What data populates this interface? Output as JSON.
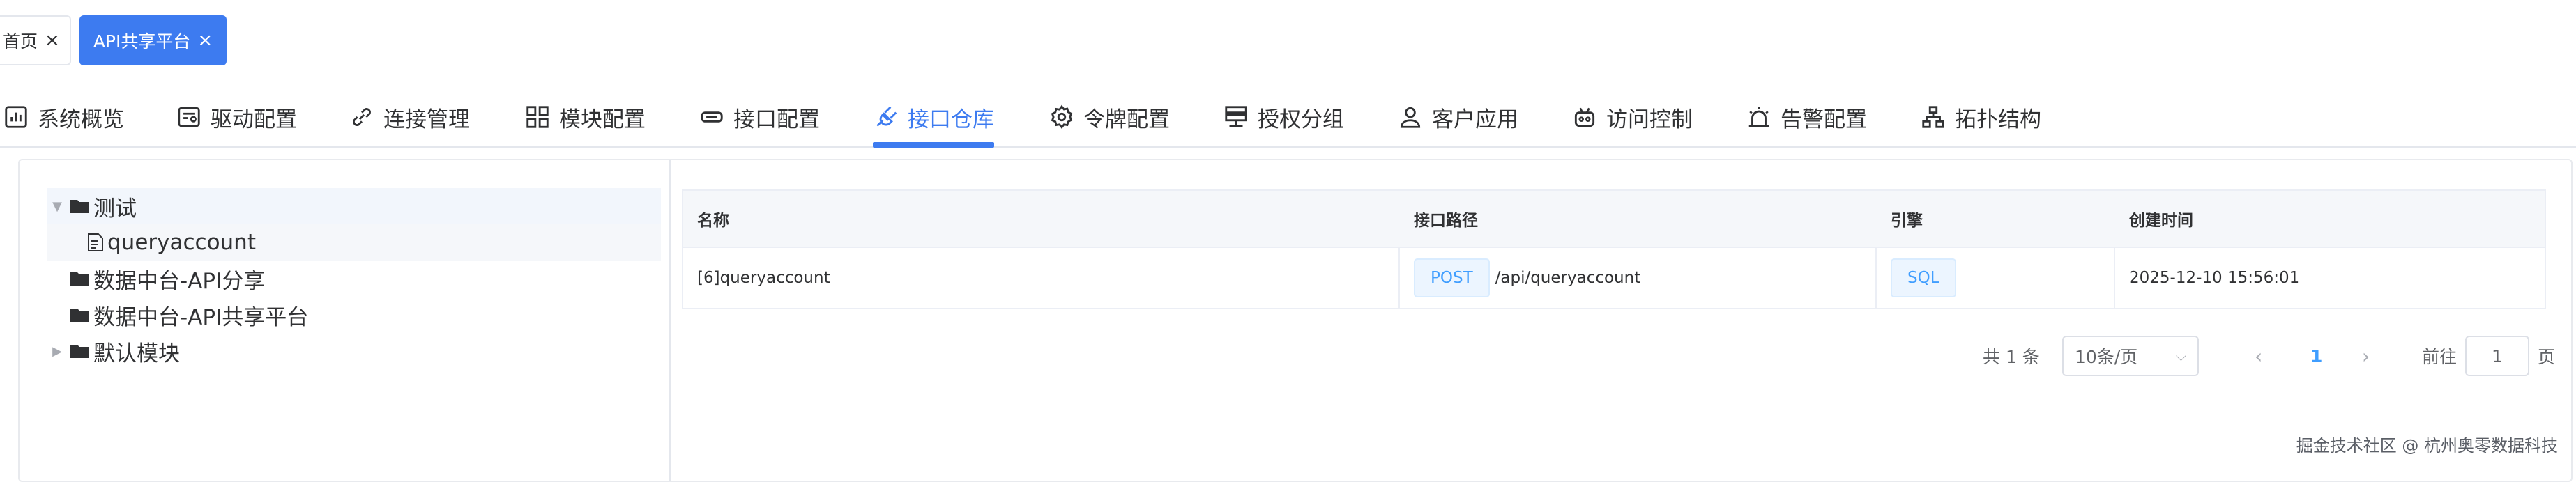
{
  "tags": [
    {
      "label": "首页",
      "close": "×"
    },
    {
      "label": "API共享平台",
      "close": "×"
    }
  ],
  "tabs": [
    {
      "label": "系统概览",
      "icon": "bar-chart-icon"
    },
    {
      "label": "驱动配置",
      "icon": "driver-icon"
    },
    {
      "label": "连接管理",
      "icon": "link-icon"
    },
    {
      "label": "模块配置",
      "icon": "grid-icon"
    },
    {
      "label": "接口配置",
      "icon": "interface-icon"
    },
    {
      "label": "接口仓库",
      "icon": "plug-icon",
      "active": true
    },
    {
      "label": "令牌配置",
      "icon": "gear-icon"
    },
    {
      "label": "授权分组",
      "icon": "server-icon"
    },
    {
      "label": "客户应用",
      "icon": "user-icon"
    },
    {
      "label": "访问控制",
      "icon": "robot-icon"
    },
    {
      "label": "告警配置",
      "icon": "alarm-icon"
    },
    {
      "label": "拓扑结构",
      "icon": "topology-icon"
    }
  ],
  "tree": [
    {
      "label": "测试",
      "expanded": true,
      "children": [
        {
          "label": "queryaccount"
        }
      ]
    },
    {
      "label": "数据中台-API分享"
    },
    {
      "label": "数据中台-API共享平台"
    },
    {
      "label": "默认模块",
      "expanded": false
    }
  ],
  "table": {
    "columns": [
      "名称",
      "接口路径",
      "引擎",
      "创建时间"
    ],
    "rows": [
      {
        "name": "[6]queryaccount",
        "method": "POST",
        "path": "/api/queryaccount",
        "engine": "SQL",
        "created": "2025-12-10 15:56:01"
      }
    ]
  },
  "pagination": {
    "total": "共 1 条",
    "page_size": "10条/页",
    "prev": "‹",
    "current": "1",
    "next": "›",
    "goto_label": "前往",
    "goto_value": "1",
    "page_suffix": "页"
  },
  "watermark": "掘金技术社区 @ 杭州奥零数据科技",
  "colors": {
    "accent": "#3d7bf0",
    "method_tag": "#409eff"
  }
}
